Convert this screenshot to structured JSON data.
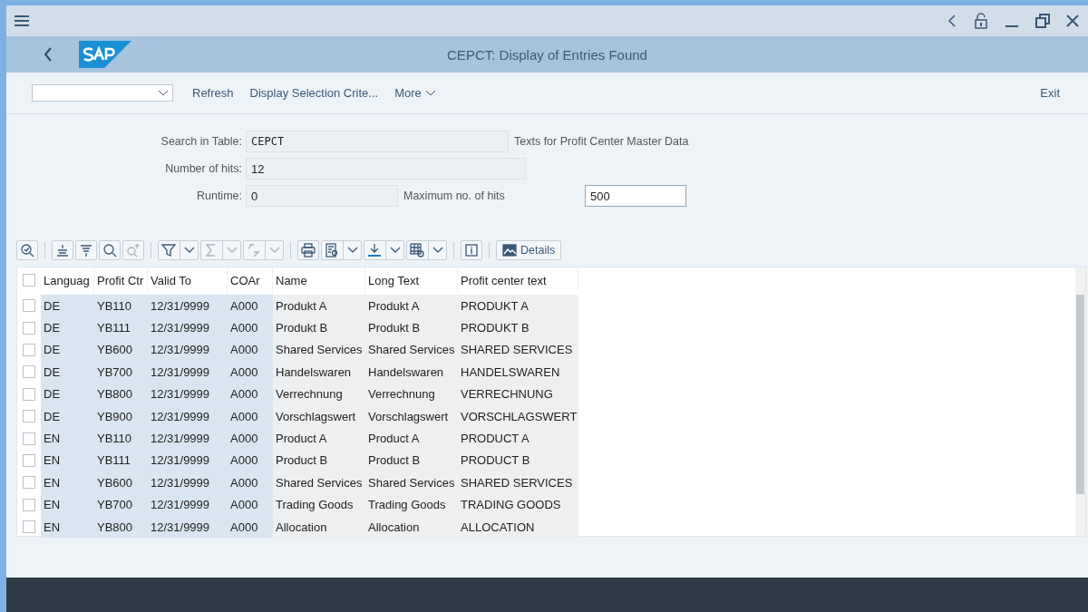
{
  "window": {
    "title": "CEPCT: Display of Entries Found"
  },
  "toolbar": {
    "actions": [
      "Refresh",
      "Display Selection Crite...",
      "More"
    ],
    "exit": "Exit"
  },
  "form": {
    "table_label": "Search in Table:",
    "table_value": "CEPCT",
    "table_description": "Texts for Profit Center Master Data",
    "hits_label": "Number of hits:",
    "hits_value": "12",
    "runtime_label": "Runtime:",
    "runtime_value": "0",
    "max_label": "Maximum no. of hits",
    "max_value": "500"
  },
  "grid_tools": [
    {
      "kind": "icon",
      "disabled": false
    },
    {
      "kind": "icon",
      "disabled": false
    },
    {
      "kind": "icon",
      "disabled": false
    },
    {
      "kind": "icon",
      "disabled": false
    },
    {
      "kind": "icon",
      "disabled": true
    },
    {
      "kind": "split",
      "disabled": false
    },
    {
      "kind": "split",
      "disabled": true
    },
    {
      "kind": "split",
      "disabled": true
    },
    {
      "kind": "icon",
      "disabled": false
    },
    {
      "kind": "split",
      "disabled": false
    },
    {
      "kind": "split",
      "disabled": false
    },
    {
      "kind": "split",
      "disabled": false
    },
    {
      "kind": "icon",
      "disabled": false
    },
    {
      "kind": "text",
      "label": "Details",
      "disabled": false
    }
  ],
  "table": {
    "select_all_checked": false,
    "columns": [
      {
        "label": "Languag",
        "key": true
      },
      {
        "label": "Profit Ctr",
        "key": true
      },
      {
        "label": "Valid To",
        "key": true
      },
      {
        "label": "COAr",
        "key": true
      },
      {
        "label": "Name",
        "key": false
      },
      {
        "label": "Long Text",
        "key": false
      },
      {
        "label": "Profit center text",
        "key": false
      }
    ],
    "rows": [
      {
        "checked": false,
        "cells": [
          "DE",
          "YB110",
          "12/31/9999",
          "A000",
          "Produkt A",
          "Produkt A",
          "PRODUKT A"
        ]
      },
      {
        "checked": false,
        "cells": [
          "DE",
          "YB111",
          "12/31/9999",
          "A000",
          "Produkt B",
          "Produkt B",
          "PRODUKT B"
        ]
      },
      {
        "checked": false,
        "cells": [
          "DE",
          "YB600",
          "12/31/9999",
          "A000",
          "Shared Services",
          "Shared Services",
          "SHARED SERVICES"
        ]
      },
      {
        "checked": false,
        "cells": [
          "DE",
          "YB700",
          "12/31/9999",
          "A000",
          "Handelswaren",
          "Handelswaren",
          "HANDELSWAREN"
        ]
      },
      {
        "checked": false,
        "cells": [
          "DE",
          "YB800",
          "12/31/9999",
          "A000",
          "Verrechnung",
          "Verrechnung",
          "VERRECHNUNG"
        ]
      },
      {
        "checked": false,
        "cells": [
          "DE",
          "YB900",
          "12/31/9999",
          "A000",
          "Vorschlagswert",
          "Vorschlagswert",
          "VORSCHLAGSWERT"
        ]
      },
      {
        "checked": false,
        "cells": [
          "EN",
          "YB110",
          "12/31/9999",
          "A000",
          "Product A",
          "Product A",
          "PRODUCT A"
        ]
      },
      {
        "checked": false,
        "cells": [
          "EN",
          "YB111",
          "12/31/9999",
          "A000",
          "Product B",
          "Product B",
          "PRODUCT B"
        ]
      },
      {
        "checked": false,
        "cells": [
          "EN",
          "YB600",
          "12/31/9999",
          "A000",
          "Shared Services",
          "Shared Services",
          "SHARED SERVICES"
        ]
      },
      {
        "checked": false,
        "cells": [
          "EN",
          "YB700",
          "12/31/9999",
          "A000",
          "Trading Goods",
          "Trading Goods",
          "TRADING GOODS"
        ]
      },
      {
        "checked": false,
        "cells": [
          "EN",
          "YB800",
          "12/31/9999",
          "A000",
          "Allocation",
          "Allocation",
          "ALLOCATION"
        ]
      }
    ]
  }
}
